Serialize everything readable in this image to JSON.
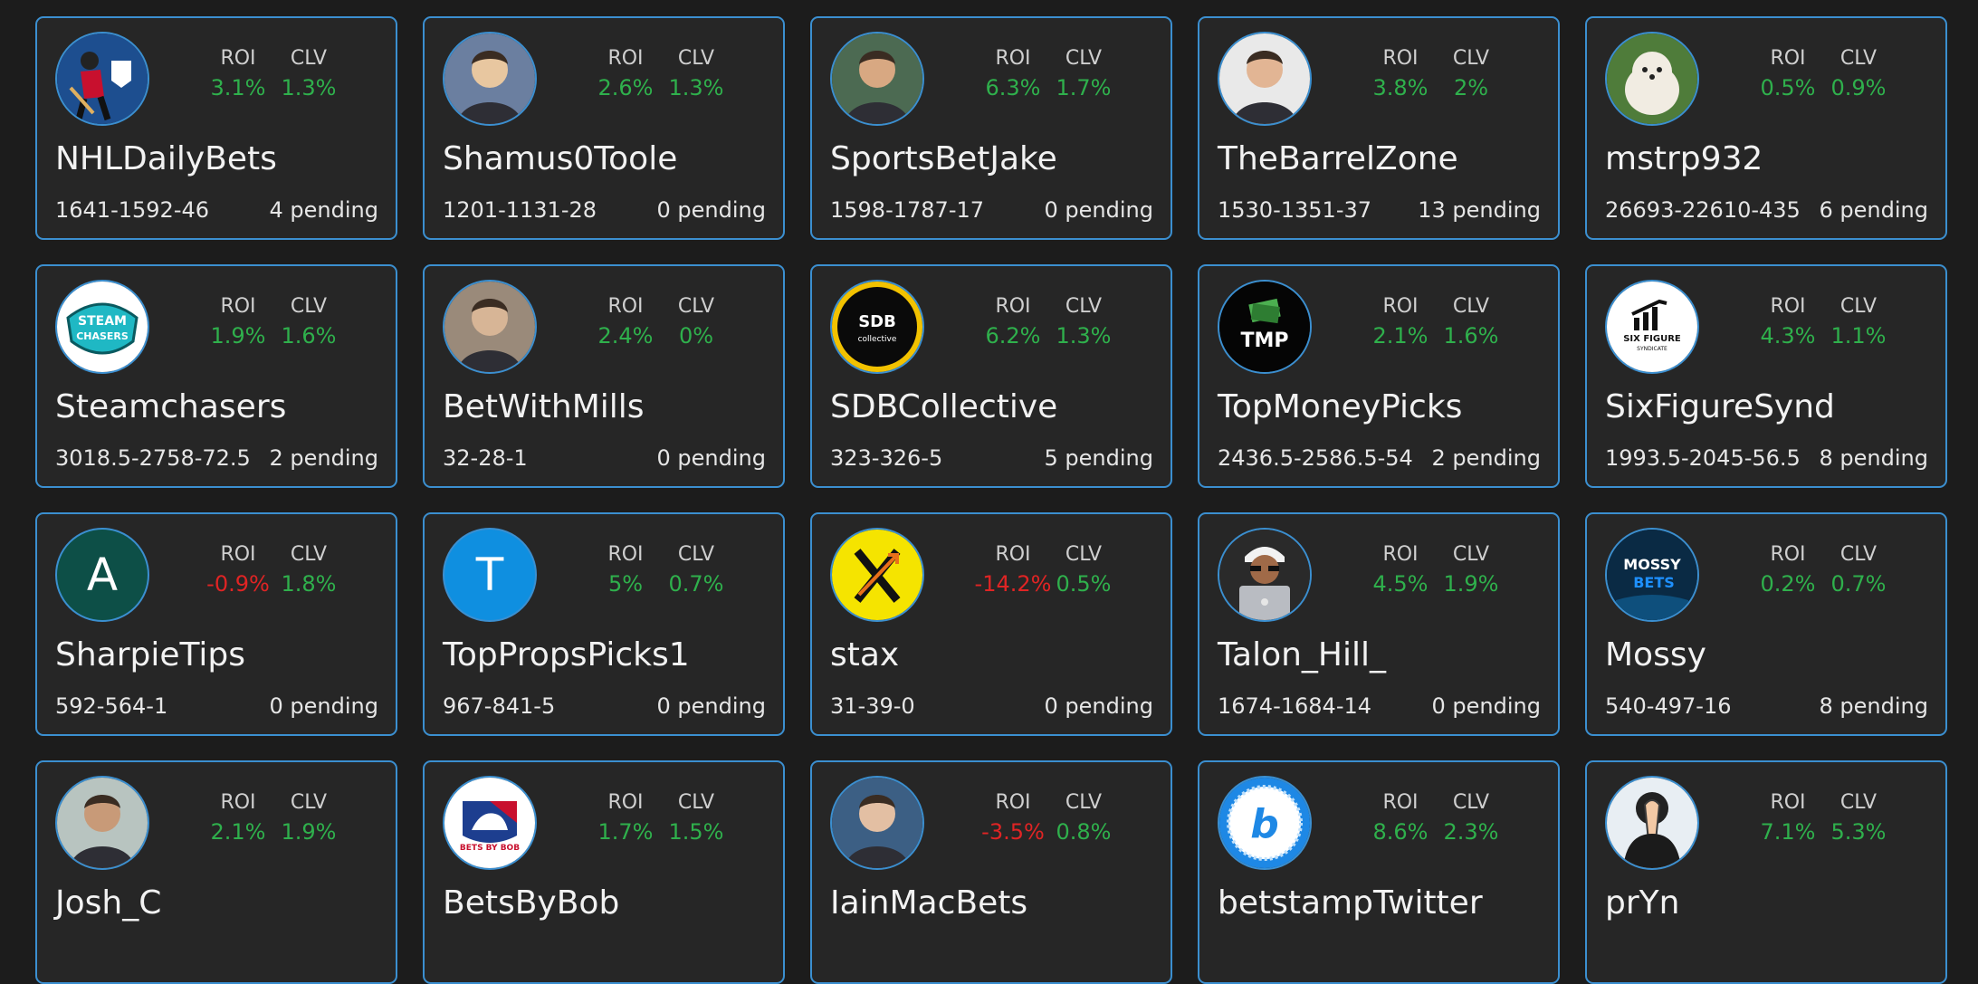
{
  "labels": {
    "roi": "ROI",
    "clv": "CLV"
  },
  "colors": {
    "positive": "#2fb04c",
    "negative": "#e02424",
    "border": "#3b8fd0",
    "card": "#262626",
    "background": "#1c1c1c"
  },
  "cards": [
    {
      "name": "NHLDailyBets",
      "roi": "3.1%",
      "clv": "1.3%",
      "record": "1641-1592-46",
      "pending": "4 pending",
      "roi_sign": "pos",
      "avatar": {
        "icon": "hockey-player-logo",
        "bg": "#1d4e8f",
        "fg": "#c8102e"
      }
    },
    {
      "name": "Shamus0Toole",
      "roi": "2.6%",
      "clv": "1.3%",
      "record": "1201-1131-28",
      "pending": "0 pending",
      "roi_sign": "pos",
      "avatar": {
        "icon": "person-photo",
        "bg": "#6b7fa0",
        "fg": "#e8c7a0"
      }
    },
    {
      "name": "SportsBetJake",
      "roi": "6.3%",
      "clv": "1.7%",
      "record": "1598-1787-17",
      "pending": "0 pending",
      "roi_sign": "pos",
      "avatar": {
        "icon": "person-photo",
        "bg": "#4c6a52",
        "fg": "#d8a882"
      }
    },
    {
      "name": "TheBarrelZone",
      "roi": "3.8%",
      "clv": "2%",
      "record": "1530-1351-37",
      "pending": "13 pending",
      "roi_sign": "pos",
      "avatar": {
        "icon": "person-photo",
        "bg": "#e9e9e9",
        "fg": "#e2b594"
      }
    },
    {
      "name": "mstrp932",
      "roi": "0.5%",
      "clv": "0.9%",
      "record": "26693-22610-435",
      "pending": "6 pending",
      "roi_sign": "pos",
      "avatar": {
        "icon": "dog-photo",
        "bg": "#4f7c3a",
        "fg": "#f1ece2"
      }
    },
    {
      "name": "Steamchasers",
      "roi": "1.9%",
      "clv": "1.6%",
      "record": "3018.5-2758-72.5",
      "pending": "2 pending",
      "roi_sign": "pos",
      "avatar": {
        "icon": "steamchasers-logo",
        "bg": "#ffffff",
        "fg": "#1fb8c4"
      }
    },
    {
      "name": "BetWithMills",
      "roi": "2.4%",
      "clv": "0%",
      "record": "32-28-1",
      "pending": "0 pending",
      "roi_sign": "pos",
      "avatar": {
        "icon": "person-photo",
        "bg": "#9a8a7a",
        "fg": "#d7b596"
      }
    },
    {
      "name": "SDBCollective",
      "roi": "6.2%",
      "clv": "1.3%",
      "record": "323-326-5",
      "pending": "5 pending",
      "roi_sign": "pos",
      "avatar": {
        "icon": "sdb-collective-logo",
        "bg": "#0a0a0a",
        "fg": "#f2c200",
        "logo_text": "SDB",
        "logo_sub": "collective"
      }
    },
    {
      "name": "TopMoneyPicks",
      "roi": "2.1%",
      "clv": "1.6%",
      "record": "2436.5-2586.5-54",
      "pending": "2 pending",
      "roi_sign": "pos",
      "avatar": {
        "icon": "tmp-money-logo",
        "bg": "#050505",
        "fg": "#4caf50",
        "logo_text": "TMP"
      }
    },
    {
      "name": "SixFigureSynd",
      "roi": "4.3%",
      "clv": "1.1%",
      "record": "1993.5-2045-56.5",
      "pending": "8 pending",
      "roi_sign": "pos",
      "avatar": {
        "icon": "six-figure-syndicate-logo",
        "bg": "#ffffff",
        "fg": "#111111",
        "logo_text": "SIX FIGURE",
        "logo_sub": "SYNDICATE"
      }
    },
    {
      "name": "SharpieTips",
      "roi": "-0.9%",
      "clv": "1.8%",
      "record": "592-564-1",
      "pending": "0 pending",
      "roi_sign": "neg",
      "avatar": {
        "icon": "letter-avatar",
        "bg": "#0d4f47",
        "fg": "#ffffff",
        "letter": "A"
      }
    },
    {
      "name": "TopPropsPicks1",
      "roi": "5%",
      "clv": "0.7%",
      "record": "967-841-5",
      "pending": "0 pending",
      "roi_sign": "pos",
      "avatar": {
        "icon": "letter-avatar",
        "bg": "#0f8fe0",
        "fg": "#ffffff",
        "letter": "T"
      }
    },
    {
      "name": "stax",
      "roi": "-14.2%",
      "clv": "0.5%",
      "record": "31-39-0",
      "pending": "0 pending",
      "roi_sign": "neg",
      "avatar": {
        "icon": "stax-x-logo",
        "bg": "#f5e400",
        "fg": "#111111"
      }
    },
    {
      "name": "Talon_Hill_",
      "roi": "4.5%",
      "clv": "1.9%",
      "record": "1674-1684-14",
      "pending": "0 pending",
      "roi_sign": "pos",
      "avatar": {
        "icon": "memoji-laptop",
        "bg": "#2a2a2a",
        "fg": "#b9bcc2"
      }
    },
    {
      "name": "Mossy",
      "roi": "0.2%",
      "clv": "0.7%",
      "record": "540-497-16",
      "pending": "8 pending",
      "roi_sign": "pos",
      "avatar": {
        "icon": "mossy-bets-logo",
        "bg": "#0a2a44",
        "fg": "#1e90ff",
        "logo_text": "MOSSY",
        "logo_sub": "BETS"
      }
    },
    {
      "name": "Josh_C",
      "roi": "2.1%",
      "clv": "1.9%",
      "record": "",
      "pending": "",
      "roi_sign": "pos",
      "avatar": {
        "icon": "person-photo",
        "bg": "#b8c4c0",
        "fg": "#c89a78"
      }
    },
    {
      "name": "BetsByBob",
      "roi": "1.7%",
      "clv": "1.5%",
      "record": "",
      "pending": "",
      "roi_sign": "pos",
      "avatar": {
        "icon": "bets-by-bob-logo",
        "bg": "#ffffff",
        "fg": "#c8102e",
        "logo_text": "BETS BY BOB"
      }
    },
    {
      "name": "IainMacBets",
      "roi": "-3.5%",
      "clv": "0.8%",
      "record": "",
      "pending": "",
      "roi_sign": "neg",
      "avatar": {
        "icon": "person-photo",
        "bg": "#3c5f84",
        "fg": "#e3bfa3"
      }
    },
    {
      "name": "betstampTwitter",
      "roi": "8.6%",
      "clv": "2.3%",
      "record": "",
      "pending": "",
      "roi_sign": "pos",
      "avatar": {
        "icon": "betstamp-b-logo",
        "bg": "#ffffff",
        "fg": "#1e88e5",
        "letter": "b"
      }
    },
    {
      "name": "prYn",
      "roi": "7.1%",
      "clv": "5.3%",
      "record": "",
      "pending": "",
      "roi_sign": "pos",
      "avatar": {
        "icon": "praying-hands-illustration",
        "bg": "#e8eef3",
        "fg": "#3a3a3a"
      }
    }
  ]
}
